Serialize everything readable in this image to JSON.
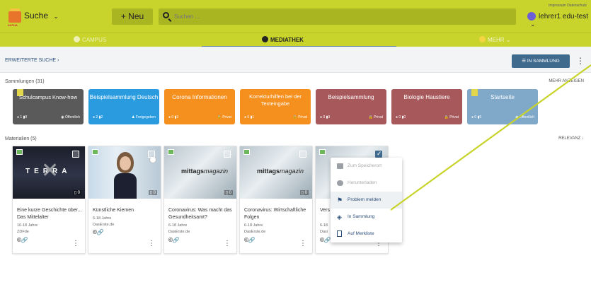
{
  "header": {
    "logo_text": "ALPHA",
    "search_menu_label": "Suche",
    "new_label": "+ Neu",
    "search_placeholder": "Suchen ...",
    "impressum": "Impressum  Datenschutz",
    "user_name": "lehrer1 edu-test"
  },
  "nav": {
    "tabs": [
      {
        "label": "CAMPUS"
      },
      {
        "label": "MEDIATHEK"
      },
      {
        "label": "MEHR"
      }
    ]
  },
  "toolbar": {
    "erweiterte_suche": "ERWEITERTE SUCHE",
    "in_sammlung_label": "IN SAMMLUNG"
  },
  "collections": {
    "heading": "Sammlungen (31)",
    "more_label": "MEHR ANZEIGEN",
    "items": [
      {
        "title": "Schulcampus Know-how",
        "c1": "1",
        "c2": "9",
        "status": "Öffentlich",
        "color": "#6f6f6f"
      },
      {
        "title": "Beispielsammlung Deutsch",
        "c1": "2",
        "c2": "2",
        "status": "Freigegeben",
        "color": "#2b9be0"
      },
      {
        "title": "Corona Informationen",
        "c1": "0",
        "c2": "3",
        "status": "Privat",
        "color": "#f5901e"
      },
      {
        "title": "Korrekturhilfen bei der Texteingabe",
        "c1": "0",
        "c2": "1",
        "status": "Privat",
        "color": "#f5901e"
      },
      {
        "title": "Beispielsammlung",
        "c1": "0",
        "c2": "0",
        "status": "Privat",
        "color": "#a6585b"
      },
      {
        "title": "Biologie Haustiere",
        "c1": "0",
        "c2": "0",
        "status": "Privat",
        "color": "#a6585b"
      },
      {
        "title": "Startseite",
        "c1": "0",
        "c2": "5",
        "status": "Öffentlich",
        "color": "#7fa8c9"
      }
    ]
  },
  "materials": {
    "heading": "Materialien (5)",
    "sort_label": "RELEVANZ",
    "items": [
      {
        "title": "Eine kurze Geschichte über... Das Mittelalter",
        "age": "10-18 Jahre",
        "source": "ZDFde",
        "count": "0",
        "license": "©🔗"
      },
      {
        "title": "Künstliche Kiemen",
        "age": "6-18 Jahre",
        "source": "DasErste.de",
        "count": "0",
        "license": "©🔗"
      },
      {
        "title": "Coronavirus: Was macht das Gesundheitsamt?",
        "age": "6-18 Jahre",
        "source": "DasErste.de",
        "count": "0",
        "license": "©🔗"
      },
      {
        "title": "Coronavirus: Wirtschaftliche Folgen",
        "age": "6-18 Jahre",
        "source": "DasErste.de",
        "count": "0",
        "license": "©🔗"
      },
      {
        "title": "Vers Chin",
        "age": "6-18",
        "source": "Dasi",
        "count": "0",
        "license": "©🔗"
      }
    ]
  },
  "context_menu": {
    "items": [
      {
        "label": "Zum Speicherort"
      },
      {
        "label": "Herunterladen"
      },
      {
        "label": "Problem melden"
      },
      {
        "label": "In Sammlung"
      },
      {
        "label": "Auf Merkliste"
      }
    ]
  },
  "thumb_labels": {
    "terra": "TERRA",
    "mittags": "mittags",
    "magazin": "magazin"
  }
}
